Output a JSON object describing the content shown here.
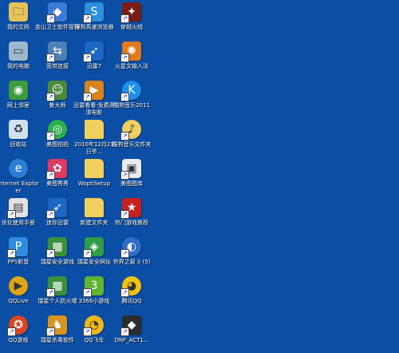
{
  "desktop": {
    "background": "#0a4fa5",
    "icons": [
      {
        "label": "我的文档",
        "icon": "my-documents-icon",
        "color": "#e3c35a",
        "glyph": "🗀",
        "shortcut": false
      },
      {
        "label": "金山卫士软件管理",
        "icon": "kingsoft-guard-icon",
        "color": "#3a7bd5",
        "glyph": "◆",
        "shortcut": true
      },
      {
        "label": "搜狗高速浏览器",
        "icon": "sogou-browser-icon",
        "color": "#2d8fe0",
        "glyph": "S",
        "shortcut": true
      },
      {
        "label": "穿越火线",
        "icon": "crossfire-icon",
        "color": "#7a1c16",
        "glyph": "✦",
        "shortcut": true
      },
      {
        "label": "我的电脑",
        "icon": "my-computer-icon",
        "color": "#9db7cf",
        "glyph": "▭",
        "shortcut": false
      },
      {
        "label": "宽带连接",
        "icon": "broadband-connection-icon",
        "color": "#4d7fb8",
        "glyph": "⇆",
        "shortcut": true
      },
      {
        "label": "迅雷7",
        "icon": "thunder-icon",
        "color": "#1a67c4",
        "glyph": "➶",
        "shortcut": true
      },
      {
        "label": "火星文输入法",
        "icon": "martian-ime-icon",
        "color": "#e07a1e",
        "glyph": "✺",
        "shortcut": true
      },
      {
        "label": "网上邻居",
        "icon": "network-places-icon",
        "color": "#3c9c3c",
        "glyph": "◉",
        "shortcut": false
      },
      {
        "label": "鲁大师",
        "icon": "ludashi-icon",
        "color": "#4c8a3c",
        "glyph": "☺",
        "shortcut": true
      },
      {
        "label": "迅雷看看-免费高清电影",
        "icon": "xunlei-kankan-icon",
        "color": "#d9831c",
        "glyph": "▶",
        "shortcut": true
      },
      {
        "label": "酷狗音乐2011",
        "icon": "kugou-music-icon",
        "color": "#1e8fe8",
        "glyph": "K",
        "shortcut": true
      },
      {
        "label": "回收站",
        "icon": "recycle-bin-icon",
        "color": "#cfe2ef",
        "glyph": "♻",
        "shortcut": false
      },
      {
        "label": "美图拍拍",
        "icon": "meitu-paipai-icon",
        "color": "#2bb24c",
        "glyph": "◎",
        "shortcut": true
      },
      {
        "label": "2010年12月21日爷...",
        "icon": "folder-icon",
        "color": "#f0cf5e",
        "glyph": "",
        "shortcut": false
      },
      {
        "label": "酷狗音乐文件夹",
        "icon": "kugou-folder-icon",
        "color": "#f0cf5e",
        "glyph": "♪",
        "shortcut": true
      },
      {
        "label": "Internet Explorer",
        "icon": "internet-explorer-icon",
        "color": "#2a7fd4",
        "glyph": "e",
        "shortcut": false
      },
      {
        "label": "美图秀秀",
        "icon": "meitu-xiuxiu-icon",
        "color": "#e03b62",
        "glyph": "✿",
        "shortcut": true
      },
      {
        "label": "WoptiSetup",
        "icon": "folder-icon",
        "color": "#f0cf5e",
        "glyph": "",
        "shortcut": false
      },
      {
        "label": "美图图库",
        "icon": "meitu-gallery-icon",
        "color": "#e9ecef",
        "glyph": "▣",
        "shortcut": true
      },
      {
        "label": "优化使用手册",
        "icon": "optimization-manual-icon",
        "color": "#e2e2e2",
        "glyph": "▤",
        "shortcut": true
      },
      {
        "label": "迷你迅雷",
        "icon": "mini-thunder-icon",
        "color": "#1a67c4",
        "glyph": "➶",
        "shortcut": true
      },
      {
        "label": "新建文件夹",
        "icon": "folder-icon",
        "color": "#f0cf5e",
        "glyph": "",
        "shortcut": false
      },
      {
        "label": "热门游戏推荐",
        "icon": "hot-games-icon",
        "color": "#c8201c",
        "glyph": "★",
        "shortcut": true
      },
      {
        "label": "PPS影音",
        "icon": "pps-player-icon",
        "color": "#2f8ce0",
        "glyph": "P",
        "shortcut": true
      },
      {
        "label": "瑞星安全游戏",
        "icon": "rising-games-icon",
        "color": "#3c8f3c",
        "glyph": "▦",
        "shortcut": true
      },
      {
        "label": "瑞星安全网址",
        "icon": "rising-url-icon",
        "color": "#2f9e4a",
        "glyph": "◈",
        "shortcut": true
      },
      {
        "label": "世界之窗 3 (5)",
        "icon": "theworld-browser-icon",
        "color": "#2d6ec8",
        "glyph": "◐",
        "shortcut": true
      },
      {
        "label": "QQLive",
        "icon": "qqlive-icon",
        "color": "#e1a514",
        "glyph": "▶",
        "shortcut": false
      },
      {
        "label": "瑞星个人防火墙",
        "icon": "rising-firewall-icon",
        "color": "#3c8f3c",
        "glyph": "▦",
        "shortcut": true
      },
      {
        "label": "3366小游戏",
        "icon": "3366-games-icon",
        "color": "#61b52f",
        "glyph": "3",
        "shortcut": true
      },
      {
        "label": "腾讯QQ",
        "icon": "tencent-qq-icon",
        "color": "#f4c20d",
        "glyph": "◕",
        "shortcut": true
      },
      {
        "label": "QQ游戏",
        "icon": "qq-game-icon",
        "color": "#d9471f",
        "glyph": "✪",
        "shortcut": true
      },
      {
        "label": "瑞星杀毒软件",
        "icon": "rising-antivirus-icon",
        "color": "#d8941e",
        "glyph": "♞",
        "shortcut": true
      },
      {
        "label": "QQ飞车",
        "icon": "qq-speed-icon",
        "color": "#f0b81a",
        "glyph": "◔",
        "shortcut": true
      },
      {
        "label": "DNF_ACT1...",
        "icon": "dnf-icon",
        "color": "#2c2c2c",
        "glyph": "◆",
        "shortcut": true
      }
    ]
  }
}
